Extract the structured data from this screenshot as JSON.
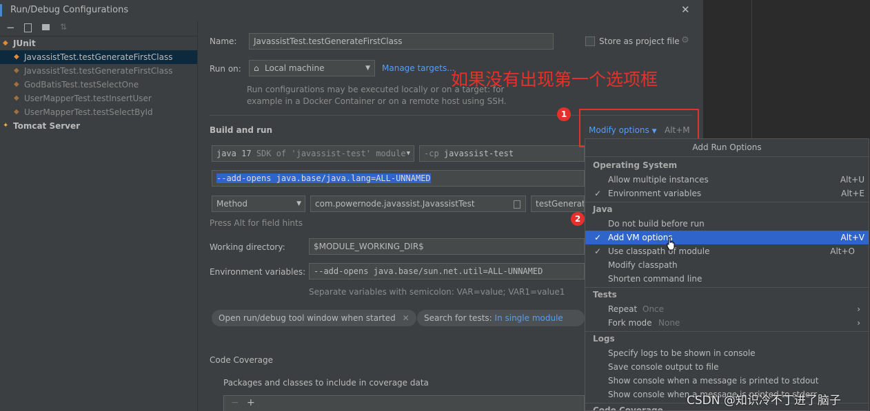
{
  "window": {
    "title": "Run/Debug Configurations",
    "close_glyph": "✕"
  },
  "sidebar": {
    "items": [
      {
        "label": "JUnit",
        "kind": "group",
        "icon": "junit-icon"
      },
      {
        "label": "JavassistTest.testGenerateFirstClass",
        "kind": "selected",
        "icon": "junit-test-icon"
      },
      {
        "label": "JavassistTest.testGenerateFirstClass",
        "kind": "temp",
        "icon": "junit-test-icon"
      },
      {
        "label": "GodBatisTest.testSelectOne",
        "kind": "temp",
        "icon": "junit-test-icon"
      },
      {
        "label": "UserMapperTest.testInsertUser",
        "kind": "temp",
        "icon": "junit-test-icon"
      },
      {
        "label": "UserMapperTest.testSelectById",
        "kind": "temp",
        "icon": "junit-test-icon"
      },
      {
        "label": "Tomcat Server",
        "kind": "group",
        "icon": "tomcat-icon"
      }
    ]
  },
  "form": {
    "name_label": "Name:",
    "name_value": "JavassistTest.testGenerateFirstClass",
    "store_label": "Store as project file",
    "run_on_label": "Run on:",
    "run_on_value": "Local machine",
    "manage_targets": "Manage targets...",
    "run_on_hint_1": "Run configurations may be executed locally or on a target: for",
    "run_on_hint_2": "example in a Docker Container or on a remote host using SSH.",
    "build_run_title": "Build and run",
    "modify_options": "Modify options",
    "modify_shortcut": "Alt+M",
    "jdk_main": "java 17",
    "jdk_hint": "SDK of 'javassist-test' module",
    "cp_prefix": "-cp",
    "cp_value": "javassist-test",
    "vm_options": "--add-opens java.base/java.lang=ALL-UNNAMED",
    "test_kind": "Method",
    "test_class": "com.powernode.javassist.JavassistTest",
    "test_method": "testGenerate",
    "field_hints": "Press Alt for field hints",
    "workdir_label": "Working directory:",
    "workdir_value": "$MODULE_WORKING_DIR$",
    "env_label": "Environment variables:",
    "env_value": "--add-opens java.base/sun.net.util=ALL-UNNAMED",
    "env_hint": "Separate variables with semicolon: VAR=value; VAR1=value1",
    "chip_open_tool": "Open run/debug tool window when started",
    "chip_search_prefix": "Search for tests:",
    "chip_search_value": "In single module",
    "coverage_title": "Code Coverage",
    "coverage_packages": "Packages and classes to include in coverage data"
  },
  "annotation": {
    "text": "如果没有出现第一个选项框",
    "badge1": "1",
    "badge2": "2",
    "color": "#e4312b"
  },
  "popup": {
    "title": "Add Run Options",
    "groups": {
      "os": "Operating System",
      "java": "Java",
      "tests": "Tests",
      "logs": "Logs",
      "coverage": "Code Coverage"
    },
    "items": {
      "allow_multiple": {
        "label": "Allow multiple instances",
        "shortcut": "Alt+U"
      },
      "env_vars": {
        "label": "Environment variables",
        "shortcut": "Alt+E",
        "checked": true
      },
      "no_build": {
        "label": "Do not build before run"
      },
      "add_vm": {
        "label": "Add VM options",
        "shortcut": "Alt+V",
        "checked": true
      },
      "use_classpath": {
        "label": "Use classpath of module",
        "shortcut": "Alt+O",
        "checked": true
      },
      "modify_classpath": {
        "label": "Modify classpath"
      },
      "shorten_cmd": {
        "label": "Shorten command line"
      },
      "repeat": {
        "label": "Repeat",
        "value": "Once"
      },
      "fork_mode": {
        "label": "Fork mode",
        "value": "None"
      },
      "specify_logs": {
        "label": "Specify logs to be shown in console"
      },
      "save_console": {
        "label": "Save console output to file"
      },
      "show_stdout": {
        "label": "Show console when a message is printed to stdout"
      },
      "show_stderr": {
        "label": "Show console when a message is printed to stderr"
      }
    }
  },
  "watermark": "CSDN @知识冷不丁进了脑子",
  "colors": {
    "accent": "#589df6",
    "selection": "#2f65ca",
    "tree_selection": "#0d293e",
    "annotation": "#e4312b",
    "background": "#3c3f41"
  }
}
